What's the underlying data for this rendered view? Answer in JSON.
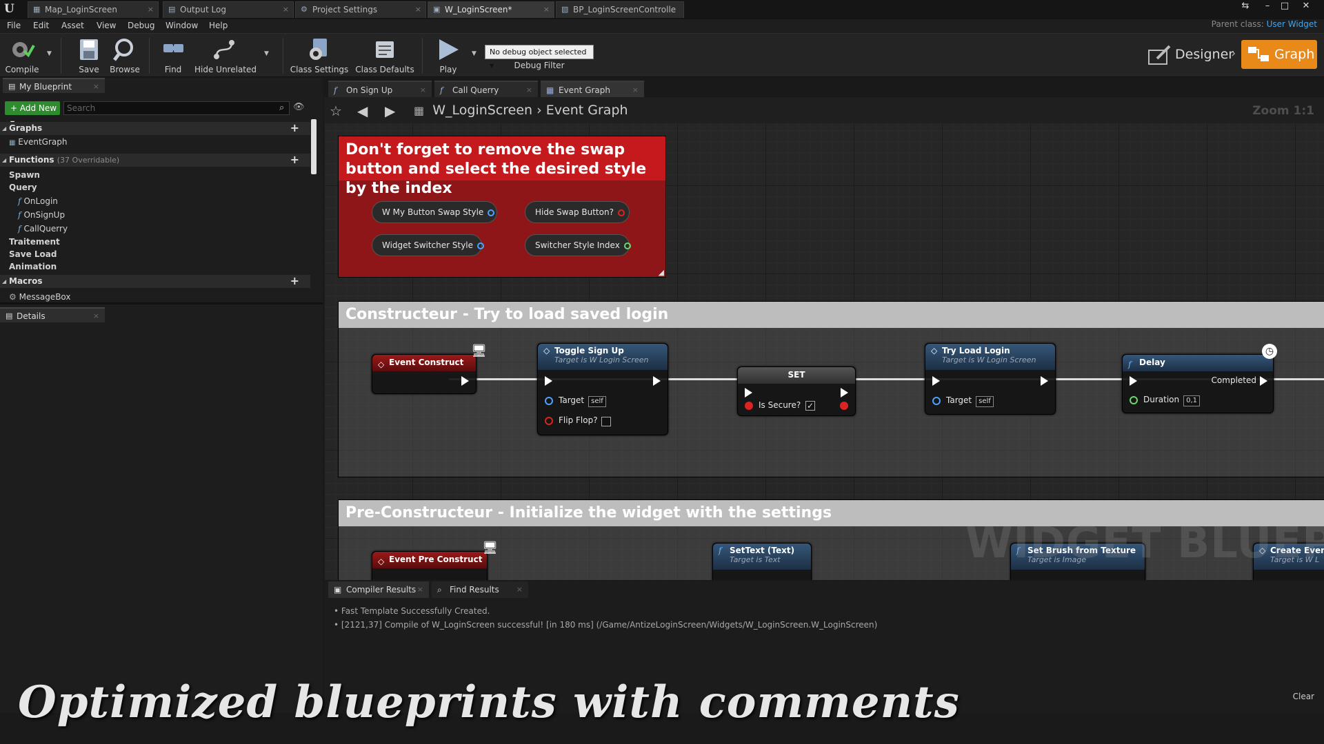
{
  "titlebar": {
    "tabs": [
      {
        "label": "Map_LoginScreen",
        "icon": "map-icon"
      },
      {
        "label": "Output Log",
        "icon": "log-icon"
      },
      {
        "label": "Project Settings",
        "icon": "settings-icon"
      },
      {
        "label": "W_LoginScreen*",
        "icon": "widget-icon"
      },
      {
        "label": "BP_LoginScreenControlle",
        "icon": "blueprint-icon"
      }
    ],
    "parent_class_label": "Parent class:",
    "parent_class_value": "User Widget"
  },
  "menu": [
    "File",
    "Edit",
    "Asset",
    "View",
    "Debug",
    "Window",
    "Help"
  ],
  "toolbar": {
    "compile": "Compile",
    "save": "Save",
    "browse": "Browse",
    "find": "Find",
    "hide_unrelated": "Hide Unrelated",
    "class_settings": "Class Settings",
    "class_defaults": "Class Defaults",
    "play": "Play",
    "debug_select": "No debug object selected",
    "debug_filter": "Debug Filter",
    "designer": "Designer",
    "graph": "Graph"
  },
  "my_blueprint": {
    "tab": "My Blueprint",
    "add_new": "Add New",
    "search_placeholder": "Search",
    "graphs": "Graphs",
    "event_graph": "EventGraph",
    "functions": "Functions",
    "functions_sub": "(37 Overridable)",
    "cat_spawn": "Spawn",
    "cat_query": "Query",
    "fn_onlogin": "OnLogin",
    "fn_onsignup": "OnSignUp",
    "fn_callquerry": "CallQuerry",
    "cat_traitement": "Traitement",
    "cat_saveload": "Save Load",
    "cat_animation": "Animation",
    "macros": "Macros",
    "macro_messagebox": "MessageBox"
  },
  "details_tab": "Details",
  "graph_tabs": [
    "On Sign Up",
    "Call Querry",
    "Event Graph"
  ],
  "breadcrumb": {
    "root": "W_LoginScreen",
    "leaf": "Event Graph"
  },
  "zoom": "Zoom 1:1",
  "red_comment": {
    "title": "Don't forget to remove the swap button and select the desired style by the index",
    "pills": [
      "W My Button Swap Style",
      "Hide Swap Button?",
      "Widget Switcher Style",
      "Switcher Style Index"
    ]
  },
  "construct_comment": "Constructeur - Try to load saved login",
  "nodes": {
    "event_construct": "Event Construct",
    "toggle_sign_up": "Toggle Sign Up",
    "toggle_sign_up_sub": "Target is W Login Screen",
    "target": "Target",
    "self": "self",
    "flip_flop": "Flip Flop?",
    "set": "SET",
    "is_secure": "Is Secure?",
    "try_load_login": "Try Load Login",
    "try_load_login_sub": "Target is W Login Screen",
    "delay": "Delay",
    "completed": "Completed",
    "duration": "Duration",
    "duration_value": "0,1"
  },
  "preconstruct_comment": "Pre-Constructeur - Initialize the widget with the settings",
  "pre_nodes": {
    "event_pre_construct": "Event Pre Construct",
    "settext": "SetText (Text)",
    "settext_sub": "Target is Text",
    "setbrush": "Set Brush from Texture",
    "setbrush_sub": "Target is Image",
    "create_event": "Create Even",
    "create_event_sub": "Target is W L"
  },
  "watermark": "WIDGET BLUEPRINT",
  "bottom": {
    "tabs": [
      "Compiler Results",
      "Find Results"
    ],
    "log": [
      "Fast Template Successfully Created.",
      "[2121,37] Compile of W_LoginScreen successful! [in 180 ms] (/Game/AntizeLoginScreen/Widgets/W_LoginScreen.W_LoginScreen)"
    ],
    "clear": "Clear"
  },
  "caption": "Optimized blueprints with comments",
  "colors": {
    "accent": "#e8891a",
    "comment_red": "#c41a1e",
    "function_blue": "#4ba3ff"
  }
}
